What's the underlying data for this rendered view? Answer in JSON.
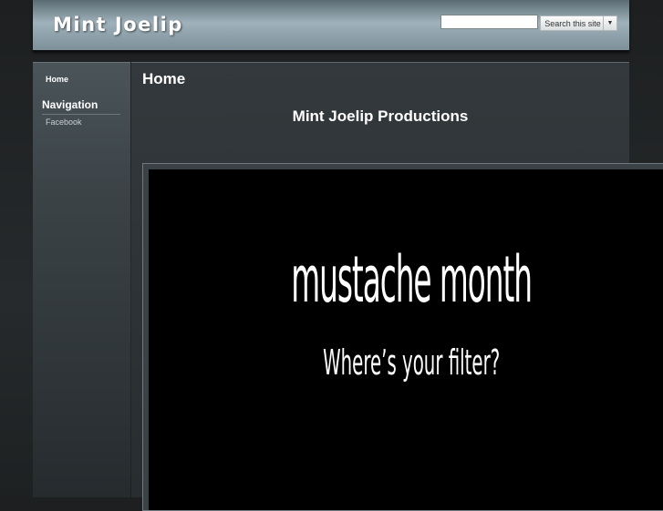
{
  "site": {
    "title": "Mint Joelip"
  },
  "search": {
    "placeholder": "",
    "button_label": "Search this site",
    "dropdown_icon": "caret-down-icon"
  },
  "sidebar": {
    "home_label": "Home",
    "nav_heading": "Navigation",
    "items": [
      {
        "label": "Facebook"
      }
    ]
  },
  "main": {
    "title": "Home",
    "subtitle": "Mint Joelip Productions"
  },
  "video": {
    "headline": "mustache month",
    "subline": "Where’s your filter?"
  }
}
